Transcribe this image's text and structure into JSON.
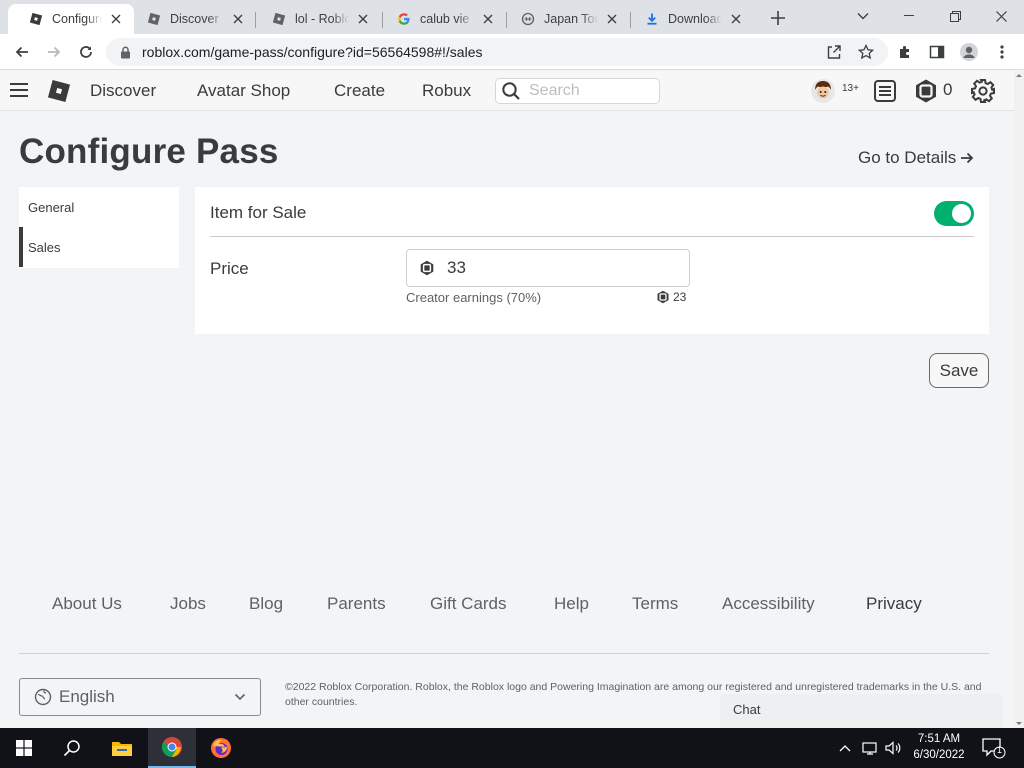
{
  "browser": {
    "tabs": [
      {
        "title": "Configure Pass",
        "icon": "roblox-icon",
        "active": true
      },
      {
        "title": "Discover - Roblox",
        "icon": "roblox-icon"
      },
      {
        "title": "lol - Roblox",
        "icon": "roblox-icon"
      },
      {
        "title": "calub vie lol",
        "icon": "google-icon"
      },
      {
        "title": "Japan Tour",
        "icon": "globe-icon"
      },
      {
        "title": "Downloads",
        "icon": "download-icon"
      }
    ],
    "url": "roblox.com/game-pass/configure?id=56564598#!/sales"
  },
  "roblox_nav": {
    "links": [
      "Discover",
      "Avatar Shop",
      "Create",
      "Robux"
    ],
    "search_placeholder": "Search",
    "age_badge": "13+",
    "robux_balance": "0"
  },
  "page": {
    "title": "Configure Pass",
    "go_to_details": "Go to Details",
    "side_menu": [
      {
        "label": "General",
        "selected": false
      },
      {
        "label": "Sales",
        "selected": true
      }
    ],
    "item_for_sale_label": "Item for Sale",
    "item_for_sale_on": true,
    "price_label": "Price",
    "price_value": "33",
    "creator_earnings_label": "Creator earnings (70%)",
    "creator_earnings_value": "23",
    "save_label": "Save"
  },
  "footer": {
    "links": [
      "About Us",
      "Jobs",
      "Blog",
      "Parents",
      "Gift Cards",
      "Help",
      "Terms",
      "Accessibility",
      "Privacy"
    ],
    "language": "English",
    "copyright": "©2022 Roblox Corporation. Roblox, the Roblox logo and Powering Imagination are among our registered and unregistered trademarks in the U.S. and other countries.",
    "chat_label": "Chat"
  },
  "taskbar": {
    "time": "7:51 AM",
    "date": "6/30/2022",
    "notification_count": "1"
  },
  "colors": {
    "toggle_on": "#00b06f",
    "text_dark": "#393b3d",
    "page_bg": "#f2f4f5"
  }
}
